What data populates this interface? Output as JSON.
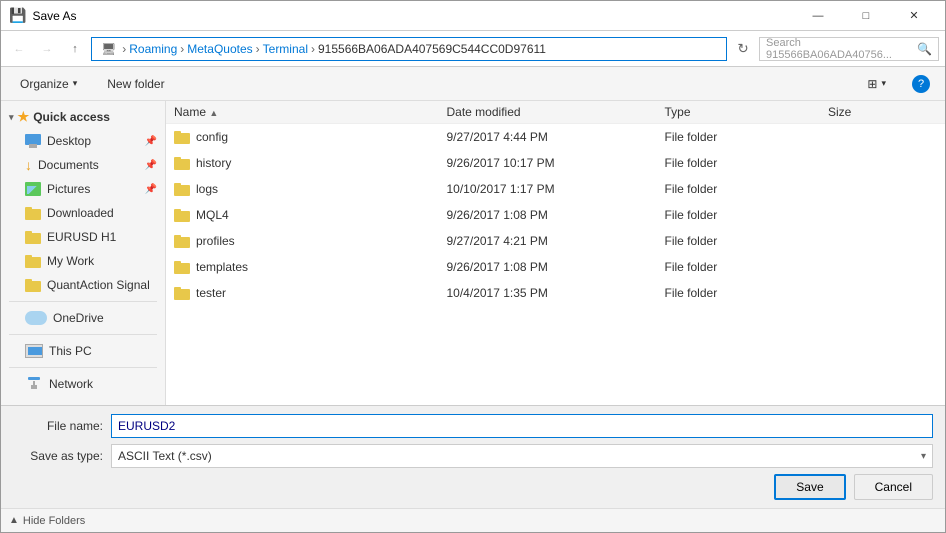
{
  "window": {
    "title": "Save As",
    "icon": "💾"
  },
  "titlebar": {
    "title": "Save As",
    "minimize": "—",
    "maximize": "□",
    "close": "✕"
  },
  "addressbar": {
    "breadcrumbs": [
      {
        "label": "Roaming",
        "sep": "›"
      },
      {
        "label": "MetaQuotes",
        "sep": "›"
      },
      {
        "label": "Terminal",
        "sep": "›"
      },
      {
        "label": "915566BA06ADA407569C544CC0D97611",
        "sep": ""
      }
    ],
    "search_placeholder": "Search 915566BA06ADA40756..."
  },
  "toolbar": {
    "organize": "Organize",
    "new_folder": "New folder"
  },
  "sidebar": {
    "quick_access_label": "Quick access",
    "items": [
      {
        "id": "desktop",
        "label": "Desktop",
        "pinned": true
      },
      {
        "id": "documents",
        "label": "Documents",
        "pinned": true
      },
      {
        "id": "pictures",
        "label": "Pictures",
        "pinned": true
      },
      {
        "id": "downloaded",
        "label": "Downloaded"
      },
      {
        "id": "eurusd",
        "label": "EURUSD H1"
      },
      {
        "id": "mywork",
        "label": "My Work"
      },
      {
        "id": "quantaction",
        "label": "QuantAction Signal"
      }
    ],
    "onedrive_label": "OneDrive",
    "thispc_label": "This PC",
    "network_label": "Network"
  },
  "filelist": {
    "columns": {
      "name": "Name",
      "date_modified": "Date modified",
      "type": "Type",
      "size": "Size"
    },
    "files": [
      {
        "name": "config",
        "date": "9/27/2017 4:44 PM",
        "type": "File folder",
        "size": ""
      },
      {
        "name": "history",
        "date": "9/26/2017 10:17 PM",
        "type": "File folder",
        "size": ""
      },
      {
        "name": "logs",
        "date": "10/10/2017 1:17 PM",
        "type": "File folder",
        "size": ""
      },
      {
        "name": "MQL4",
        "date": "9/26/2017 1:08 PM",
        "type": "File folder",
        "size": ""
      },
      {
        "name": "profiles",
        "date": "9/27/2017 4:21 PM",
        "type": "File folder",
        "size": ""
      },
      {
        "name": "templates",
        "date": "9/26/2017 1:08 PM",
        "type": "File folder",
        "size": ""
      },
      {
        "name": "tester",
        "date": "10/4/2017 1:35 PM",
        "type": "File folder",
        "size": ""
      }
    ]
  },
  "bottom": {
    "filename_label": "File name:",
    "filename_value": "EURUSD2",
    "saveas_label": "Save as type:",
    "saveas_value": "ASCII Text (*.csv)",
    "save_btn": "Save",
    "cancel_btn": "Cancel"
  },
  "statusbar": {
    "hide_folders": "Hide Folders"
  }
}
